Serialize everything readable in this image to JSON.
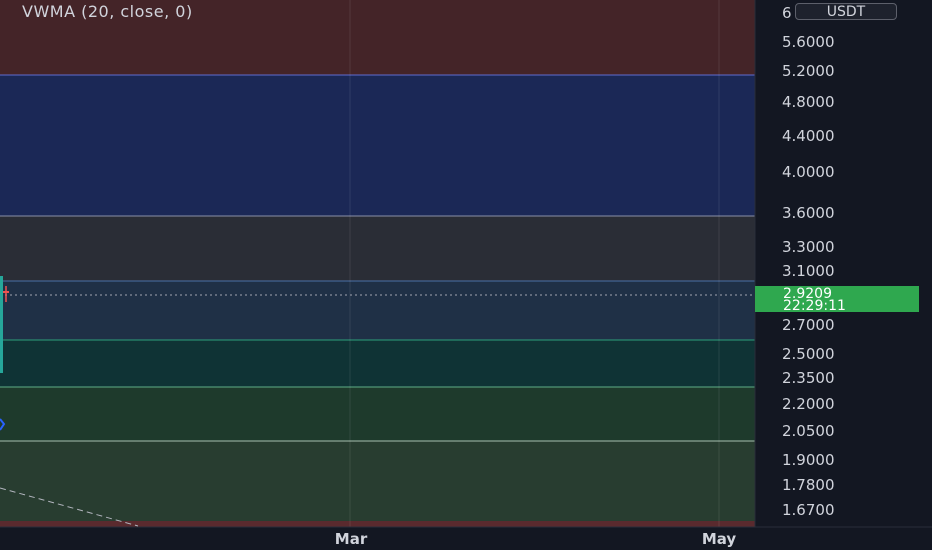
{
  "indicator": {
    "label": "VWMA (20, close, 0)"
  },
  "currency": {
    "label": "USDT"
  },
  "axis_top_fragment": "6",
  "price_axis": {
    "ticks": [
      "5.6000",
      "5.2000",
      "4.8000",
      "4.4000",
      "4.0000",
      "3.6000",
      "3.3000",
      "3.1000",
      "2.7000",
      "2.5000",
      "2.3500",
      "2.2000",
      "2.0500",
      "1.9000",
      "1.7800",
      "1.6700"
    ],
    "label_color": "#d1d4dc"
  },
  "time_axis": {
    "labels": [
      "Mar",
      "May"
    ]
  },
  "last_price": {
    "value": "2.9209",
    "countdown": "22:29:11",
    "color": "#2fa84f"
  },
  "colors": {
    "background": "#131722",
    "band_red": "#442428",
    "band_blue": "#1b2856",
    "band_grey": "#2a2d36",
    "band_steel": "#1f3046",
    "band_teal": "#0f3335",
    "band_green": "#1e3a2c",
    "band_sage": "#283d30",
    "candle_up": "#26a69a",
    "candle_down": "#ef5350"
  }
}
